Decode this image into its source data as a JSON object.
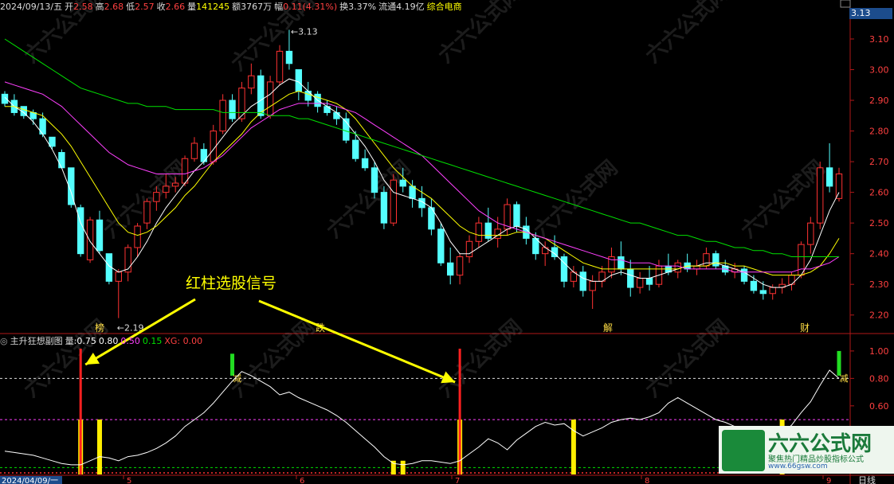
{
  "header": {
    "date": "2024/09/13/五",
    "open_label": "开",
    "open": "2.58",
    "high_label": "高",
    "high": "2.68",
    "low_label": "低",
    "low": "2.57",
    "close_label": "收",
    "close": "2.66",
    "vol_label": "量",
    "vol": "141245",
    "amt_label": "额",
    "amt": "3767万",
    "chg_label": "幅",
    "chg": "0.11(4.31%)",
    "turn_label": "换",
    "turn": "3.37%",
    "float_label": "流通",
    "float": "4.19亿",
    "sector": "综合电商"
  },
  "price_tag": "3.13",
  "sub_header": {
    "name": "主升狂想副图",
    "vol_label": "量:",
    "v1": "0.75",
    "v2": "0.80",
    "v3": "0.50",
    "v4": "0.15",
    "xg": "XG: 0.00"
  },
  "annotation": "红柱选股信号",
  "event_labels": [
    "榜",
    "跌",
    "解",
    "财"
  ],
  "max_label": "3.13",
  "min_label": "2.19",
  "sub_marks": [
    "减",
    "减"
  ],
  "x_labels": [
    "2024/04/09/一",
    "5",
    "6",
    "7",
    "8",
    "9"
  ],
  "period": "日线",
  "watermark": [
    "六六公式网"
  ],
  "logo": {
    "title": "六六公式网",
    "slogan": "聚焦热门精品炒股指标公式",
    "url": "www.66gsw.com"
  },
  "colors": {
    "up": "#ff3232",
    "down": "#54ffff",
    "ma1": "#ffffff",
    "ma2": "#ffff00",
    "ma3": "#ff40ff",
    "ma4": "#00e000"
  },
  "chart_data": [
    {
      "type": "candlestick",
      "title": "",
      "ylim": [
        2.15,
        3.17
      ],
      "y_ticks": [
        2.2,
        2.3,
        2.4,
        2.5,
        2.6,
        2.7,
        2.8,
        2.9,
        3.0,
        3.1
      ],
      "candles": [
        [
          2.92,
          2.93,
          2.88,
          2.89
        ],
        [
          2.9,
          2.92,
          2.85,
          2.86
        ],
        [
          2.88,
          2.88,
          2.84,
          2.85
        ],
        [
          2.86,
          2.87,
          2.82,
          2.84
        ],
        [
          2.84,
          2.86,
          2.78,
          2.79
        ],
        [
          2.78,
          2.78,
          2.74,
          2.75
        ],
        [
          2.73,
          2.74,
          2.68,
          2.68
        ],
        [
          2.68,
          2.68,
          2.55,
          2.56
        ],
        [
          2.55,
          2.56,
          2.39,
          2.4
        ],
        [
          2.38,
          2.52,
          2.37,
          2.51
        ],
        [
          2.51,
          2.54,
          2.4,
          2.41
        ],
        [
          2.4,
          2.4,
          2.3,
          2.31
        ],
        [
          2.31,
          2.35,
          2.19,
          2.34
        ],
        [
          2.34,
          2.43,
          2.31,
          2.42
        ],
        [
          2.42,
          2.5,
          2.39,
          2.49
        ],
        [
          2.5,
          2.58,
          2.48,
          2.57
        ],
        [
          2.57,
          2.62,
          2.54,
          2.6
        ],
        [
          2.6,
          2.66,
          2.58,
          2.62
        ],
        [
          2.62,
          2.65,
          2.6,
          2.63
        ],
        [
          2.63,
          2.72,
          2.62,
          2.71
        ],
        [
          2.71,
          2.78,
          2.7,
          2.76
        ],
        [
          2.74,
          2.76,
          2.69,
          2.7
        ],
        [
          2.7,
          2.82,
          2.69,
          2.8
        ],
        [
          2.8,
          2.92,
          2.79,
          2.9
        ],
        [
          2.9,
          2.92,
          2.83,
          2.84
        ],
        [
          2.84,
          2.96,
          2.83,
          2.94
        ],
        [
          2.94,
          3.02,
          2.92,
          2.98
        ],
        [
          2.98,
          3.0,
          2.84,
          2.85
        ],
        [
          2.85,
          2.98,
          2.84,
          2.96
        ],
        [
          2.96,
          3.08,
          2.95,
          3.06
        ],
        [
          3.06,
          3.13,
          3.0,
          3.02
        ],
        [
          3.0,
          3.0,
          2.9,
          2.93
        ],
        [
          2.93,
          2.96,
          2.88,
          2.9
        ],
        [
          2.92,
          2.93,
          2.86,
          2.88
        ],
        [
          2.88,
          2.9,
          2.85,
          2.86
        ],
        [
          2.86,
          2.88,
          2.82,
          2.84
        ],
        [
          2.84,
          2.86,
          2.76,
          2.77
        ],
        [
          2.77,
          2.8,
          2.7,
          2.71
        ],
        [
          2.71,
          2.74,
          2.67,
          2.68
        ],
        [
          2.68,
          2.7,
          2.58,
          2.6
        ],
        [
          2.6,
          2.62,
          2.48,
          2.5
        ],
        [
          2.5,
          2.66,
          2.49,
          2.64
        ],
        [
          2.64,
          2.68,
          2.6,
          2.62
        ],
        [
          2.62,
          2.64,
          2.55,
          2.58
        ],
        [
          2.58,
          2.62,
          2.52,
          2.55
        ],
        [
          2.55,
          2.58,
          2.46,
          2.48
        ],
        [
          2.48,
          2.5,
          2.36,
          2.37
        ],
        [
          2.37,
          2.42,
          2.3,
          2.33
        ],
        [
          2.33,
          2.4,
          2.3,
          2.39
        ],
        [
          2.39,
          2.46,
          2.37,
          2.44
        ],
        [
          2.44,
          2.52,
          2.42,
          2.5
        ],
        [
          2.5,
          2.55,
          2.44,
          2.45
        ],
        [
          2.45,
          2.52,
          2.42,
          2.48
        ],
        [
          2.48,
          2.58,
          2.46,
          2.56
        ],
        [
          2.56,
          2.57,
          2.47,
          2.49
        ],
        [
          2.49,
          2.52,
          2.43,
          2.45
        ],
        [
          2.45,
          2.47,
          2.38,
          2.4
        ],
        [
          2.4,
          2.44,
          2.36,
          2.42
        ],
        [
          2.42,
          2.46,
          2.38,
          2.39
        ],
        [
          2.39,
          2.4,
          2.29,
          2.31
        ],
        [
          2.31,
          2.36,
          2.29,
          2.34
        ],
        [
          2.34,
          2.36,
          2.26,
          2.28
        ],
        [
          2.28,
          2.33,
          2.22,
          2.31
        ],
        [
          2.31,
          2.36,
          2.29,
          2.34
        ],
        [
          2.34,
          2.42,
          2.32,
          2.39
        ],
        [
          2.39,
          2.44,
          2.33,
          2.35
        ],
        [
          2.35,
          2.38,
          2.26,
          2.29
        ],
        [
          2.29,
          2.34,
          2.27,
          2.32
        ],
        [
          2.32,
          2.36,
          2.28,
          2.3
        ],
        [
          2.3,
          2.38,
          2.29,
          2.36
        ],
        [
          2.36,
          2.4,
          2.33,
          2.34
        ],
        [
          2.34,
          2.38,
          2.32,
          2.37
        ],
        [
          2.37,
          2.4,
          2.34,
          2.35
        ],
        [
          2.35,
          2.38,
          2.33,
          2.36
        ],
        [
          2.36,
          2.42,
          2.35,
          2.4
        ],
        [
          2.4,
          2.41,
          2.35,
          2.36
        ],
        [
          2.36,
          2.38,
          2.33,
          2.34
        ],
        [
          2.34,
          2.37,
          2.32,
          2.35
        ],
        [
          2.35,
          2.36,
          2.3,
          2.31
        ],
        [
          2.31,
          2.33,
          2.27,
          2.28
        ],
        [
          2.28,
          2.31,
          2.25,
          2.27
        ],
        [
          2.27,
          2.3,
          2.25,
          2.29
        ],
        [
          2.29,
          2.32,
          2.27,
          2.3
        ],
        [
          2.3,
          2.34,
          2.28,
          2.33
        ],
        [
          2.33,
          2.44,
          2.32,
          2.43
        ],
        [
          2.43,
          2.52,
          2.4,
          2.5
        ],
        [
          2.5,
          2.7,
          2.48,
          2.68
        ],
        [
          2.68,
          2.76,
          2.6,
          2.62
        ],
        [
          2.58,
          2.68,
          2.57,
          2.66
        ]
      ],
      "ma": {
        "ma1": [
          2.91,
          2.88,
          2.86,
          2.83,
          2.79,
          2.74,
          2.68,
          2.6,
          2.5,
          2.44,
          2.4,
          2.36,
          2.34,
          2.35,
          2.39,
          2.44,
          2.5,
          2.55,
          2.59,
          2.63,
          2.67,
          2.7,
          2.74,
          2.78,
          2.82,
          2.85,
          2.88,
          2.9,
          2.92,
          2.95,
          2.97,
          2.96,
          2.93,
          2.9,
          2.88,
          2.86,
          2.83,
          2.79,
          2.75,
          2.7,
          2.64,
          2.6,
          2.59,
          2.58,
          2.57,
          2.55,
          2.5,
          2.44,
          2.4,
          2.4,
          2.42,
          2.44,
          2.46,
          2.48,
          2.49,
          2.48,
          2.45,
          2.42,
          2.4,
          2.37,
          2.34,
          2.32,
          2.31,
          2.31,
          2.33,
          2.34,
          2.33,
          2.32,
          2.32,
          2.33,
          2.34,
          2.35,
          2.36,
          2.36,
          2.37,
          2.37,
          2.36,
          2.35,
          2.34,
          2.32,
          2.3,
          2.29,
          2.29,
          2.3,
          2.33,
          2.38,
          2.46,
          2.54,
          2.6
        ],
        "ma2": [
          2.88,
          2.88,
          2.87,
          2.86,
          2.85,
          2.82,
          2.79,
          2.75,
          2.7,
          2.65,
          2.6,
          2.55,
          2.5,
          2.47,
          2.46,
          2.47,
          2.49,
          2.52,
          2.55,
          2.59,
          2.62,
          2.66,
          2.7,
          2.73,
          2.76,
          2.79,
          2.83,
          2.86,
          2.88,
          2.9,
          2.92,
          2.93,
          2.92,
          2.91,
          2.9,
          2.89,
          2.87,
          2.84,
          2.8,
          2.76,
          2.72,
          2.68,
          2.65,
          2.62,
          2.6,
          2.58,
          2.55,
          2.52,
          2.49,
          2.47,
          2.46,
          2.46,
          2.46,
          2.46,
          2.47,
          2.47,
          2.46,
          2.45,
          2.43,
          2.41,
          2.39,
          2.37,
          2.36,
          2.35,
          2.35,
          2.35,
          2.35,
          2.35,
          2.35,
          2.35,
          2.35,
          2.35,
          2.36,
          2.36,
          2.36,
          2.37,
          2.37,
          2.36,
          2.36,
          2.35,
          2.34,
          2.33,
          2.33,
          2.33,
          2.33,
          2.34,
          2.36,
          2.4,
          2.45
        ],
        "ma3": [
          2.96,
          2.95,
          2.94,
          2.93,
          2.92,
          2.9,
          2.88,
          2.85,
          2.82,
          2.79,
          2.76,
          2.73,
          2.71,
          2.69,
          2.68,
          2.67,
          2.66,
          2.66,
          2.66,
          2.66,
          2.67,
          2.68,
          2.7,
          2.72,
          2.75,
          2.78,
          2.81,
          2.83,
          2.85,
          2.87,
          2.88,
          2.89,
          2.89,
          2.89,
          2.89,
          2.88,
          2.87,
          2.86,
          2.84,
          2.82,
          2.8,
          2.78,
          2.76,
          2.74,
          2.72,
          2.69,
          2.66,
          2.63,
          2.6,
          2.57,
          2.54,
          2.52,
          2.5,
          2.49,
          2.48,
          2.47,
          2.46,
          2.45,
          2.44,
          2.43,
          2.42,
          2.41,
          2.4,
          2.39,
          2.38,
          2.38,
          2.37,
          2.37,
          2.37,
          2.36,
          2.36,
          2.36,
          2.35,
          2.35,
          2.35,
          2.35,
          2.35,
          2.34,
          2.34,
          2.34,
          2.34,
          2.34,
          2.34,
          2.34,
          2.35,
          2.35,
          2.36,
          2.37,
          2.39
        ],
        "ma4": [
          3.1,
          3.08,
          3.06,
          3.04,
          3.02,
          3.0,
          2.98,
          2.96,
          2.94,
          2.93,
          2.92,
          2.91,
          2.9,
          2.89,
          2.89,
          2.88,
          2.88,
          2.88,
          2.87,
          2.87,
          2.87,
          2.87,
          2.87,
          2.86,
          2.86,
          2.86,
          2.86,
          2.86,
          2.85,
          2.85,
          2.85,
          2.84,
          2.84,
          2.83,
          2.82,
          2.81,
          2.8,
          2.79,
          2.78,
          2.77,
          2.76,
          2.75,
          2.74,
          2.73,
          2.72,
          2.71,
          2.7,
          2.69,
          2.68,
          2.67,
          2.66,
          2.65,
          2.64,
          2.63,
          2.62,
          2.61,
          2.6,
          2.59,
          2.58,
          2.57,
          2.56,
          2.55,
          2.54,
          2.53,
          2.52,
          2.51,
          2.5,
          2.5,
          2.49,
          2.48,
          2.47,
          2.46,
          2.46,
          2.45,
          2.44,
          2.44,
          2.43,
          2.42,
          2.42,
          2.41,
          2.41,
          2.4,
          2.4,
          2.39,
          2.39,
          2.39,
          2.39,
          2.39,
          2.39
        ]
      }
    },
    {
      "type": "line",
      "title": "主升狂想副图",
      "ylim": [
        0.1,
        1.04
      ],
      "y_ticks": [
        0.2,
        0.4,
        0.6,
        0.8,
        1.0
      ],
      "ref_lines": [
        {
          "y": 0.8,
          "color": "#dddddd"
        },
        {
          "y": 0.5,
          "color": "#ff40ff"
        },
        {
          "y": 0.15,
          "color": "#00e000"
        }
      ],
      "values": [
        0.27,
        0.26,
        0.25,
        0.24,
        0.22,
        0.2,
        0.18,
        0.17,
        0.17,
        0.2,
        0.23,
        0.22,
        0.2,
        0.23,
        0.24,
        0.26,
        0.29,
        0.33,
        0.38,
        0.45,
        0.5,
        0.55,
        0.62,
        0.7,
        0.78,
        0.85,
        0.82,
        0.78,
        0.74,
        0.68,
        0.7,
        0.66,
        0.63,
        0.6,
        0.57,
        0.53,
        0.48,
        0.42,
        0.36,
        0.3,
        0.23,
        0.18,
        0.17,
        0.18,
        0.2,
        0.2,
        0.19,
        0.18,
        0.2,
        0.25,
        0.3,
        0.36,
        0.33,
        0.28,
        0.35,
        0.4,
        0.45,
        0.48,
        0.46,
        0.47,
        0.42,
        0.38,
        0.41,
        0.44,
        0.48,
        0.5,
        0.51,
        0.5,
        0.52,
        0.55,
        0.62,
        0.66,
        0.62,
        0.58,
        0.54,
        0.5,
        0.48,
        0.45,
        0.42,
        0.38,
        0.35,
        0.33,
        0.4,
        0.46,
        0.55,
        0.63,
        0.75,
        0.86,
        0.8
      ],
      "red_bars": [
        {
          "i": 8,
          "value": 0.5
        },
        {
          "i": 48,
          "value": 0.5
        }
      ],
      "yellow_bars": [
        {
          "i": 10,
          "value": 0.5
        },
        {
          "i": 41,
          "value": 0.2
        },
        {
          "i": 42,
          "value": 0.2
        },
        {
          "i": 60,
          "value": 0.5
        },
        {
          "i": 82,
          "value": 0.5
        }
      ],
      "green_bars": [
        {
          "i": 24,
          "value": 0.98
        },
        {
          "i": 88,
          "value": 1.0
        }
      ]
    }
  ]
}
